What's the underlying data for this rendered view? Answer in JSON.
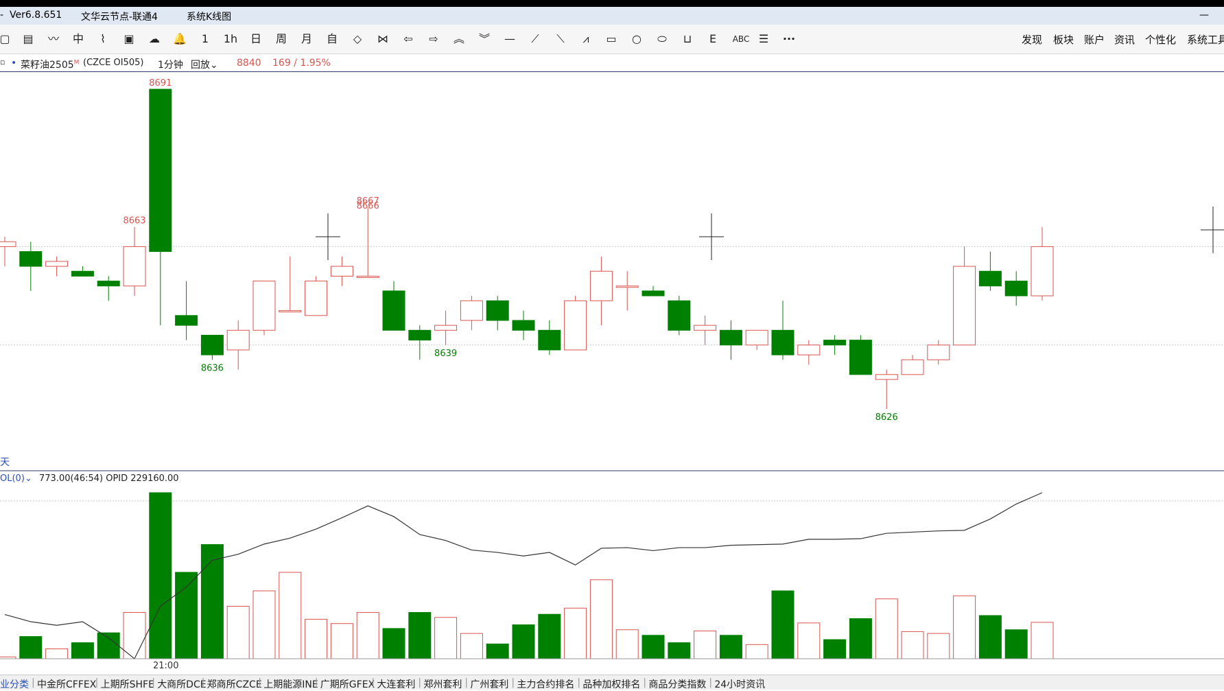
{
  "titlebar": {
    "left_dash": "-",
    "version": "Ver6.8.651",
    "node": "文华云节点-联通4",
    "window_name": "系统K线图",
    "minimize": "—"
  },
  "toolbar": {
    "icons": [
      "page-icon",
      "list-icon",
      "line-chart-icon",
      "candle-icon",
      "tick-icon",
      "report-icon",
      "cloud-icon",
      "bell-icon",
      "1m",
      "1h",
      "day",
      "week",
      "month",
      "custom",
      "left-right-icon",
      "bowtie-icon",
      "arrow-left-icon",
      "arrow-right-icon",
      "double-up-icon",
      "double-down-icon",
      "hline-icon",
      "ray-up-icon",
      "ray-down-icon",
      "zigzag-icon",
      "rect-icon",
      "circle-icon",
      "ellipse-icon",
      "ruler-icon",
      "fib-icon",
      "text-icon",
      "level-icon",
      "more-icon"
    ],
    "labels": {
      "t_1m": "1",
      "t_1h": "1h",
      "t_day": "日",
      "t_week": "周",
      "t_month": "月",
      "t_custom": "自",
      "abc": "ABC",
      "more": "···"
    },
    "right_menu": [
      "发现",
      "板块",
      "账户",
      "资讯",
      "个性化",
      "系统工具"
    ]
  },
  "infobar": {
    "contract": "菜籽油2505",
    "superscript": "M",
    "code": "(CZCE OI505)",
    "period": "1分钟",
    "replay": "回放",
    "price": "8840",
    "change": "169 / 1.95%"
  },
  "colors": {
    "up": "#d9534f",
    "down": "#008000",
    "link": "#2a4fb5",
    "grid": "#c8c8c8",
    "text": "#222222"
  },
  "chart_data": {
    "type": "candlestick",
    "price_labels": [
      {
        "value": "8691",
        "kind": "high"
      },
      {
        "value": "8667",
        "kind": "high"
      },
      {
        "value": "8666",
        "kind": "high"
      },
      {
        "value": "8663",
        "kind": "high"
      },
      {
        "value": "8636",
        "kind": "low"
      },
      {
        "value": "8639",
        "kind": "low"
      },
      {
        "value": "8626",
        "kind": "low"
      }
    ],
    "candles": [
      {
        "o": 8659,
        "h": 8661,
        "l": 8655,
        "c": 8660
      },
      {
        "o": 8658,
        "h": 8660,
        "l": 8650,
        "c": 8655
      },
      {
        "o": 8655,
        "h": 8657,
        "l": 8653,
        "c": 8656
      },
      {
        "o": 8654,
        "h": 8655,
        "l": 8653,
        "c": 8653
      },
      {
        "o": 8652,
        "h": 8653,
        "l": 8648,
        "c": 8651
      },
      {
        "o": 8651,
        "h": 8663,
        "l": 8649,
        "c": 8659
      },
      {
        "o": 8691,
        "h": 8691,
        "l": 8643,
        "c": 8658
      },
      {
        "o": 8645,
        "h": 8652,
        "l": 8640,
        "c": 8643
      },
      {
        "o": 8641,
        "h": 8641,
        "l": 8636,
        "c": 8637
      },
      {
        "o": 8638,
        "h": 8644,
        "l": 8634,
        "c": 8642
      },
      {
        "o": 8642,
        "h": 8648,
        "l": 8641,
        "c": 8652
      },
      {
        "o": 8646,
        "h": 8657,
        "l": 8646,
        "c": 8646
      },
      {
        "o": 8645,
        "h": 8653,
        "l": 8645,
        "c": 8652
      },
      {
        "o": 8653,
        "h": 8657,
        "l": 8651,
        "c": 8655
      },
      {
        "o": 8653,
        "h": 8667,
        "l": 8653,
        "c": 8653
      },
      {
        "o": 8650,
        "h": 8652,
        "l": 8643,
        "c": 8642
      },
      {
        "o": 8642,
        "h": 8643,
        "l": 8636,
        "c": 8640
      },
      {
        "o": 8642,
        "h": 8646,
        "l": 8639,
        "c": 8643
      },
      {
        "o": 8644,
        "h": 8649,
        "l": 8642,
        "c": 8648
      },
      {
        "o": 8648,
        "h": 8649,
        "l": 8642,
        "c": 8644
      },
      {
        "o": 8644,
        "h": 8646,
        "l": 8640,
        "c": 8642
      },
      {
        "o": 8642,
        "h": 8644,
        "l": 8637,
        "c": 8638
      },
      {
        "o": 8638,
        "h": 8649,
        "l": 8638,
        "c": 8648
      },
      {
        "o": 8648,
        "h": 8657,
        "l": 8643,
        "c": 8654
      },
      {
        "o": 8651,
        "h": 8654,
        "l": 8646,
        "c": 8651
      },
      {
        "o": 8650,
        "h": 8651,
        "l": 8649,
        "c": 8649
      },
      {
        "o": 8648,
        "h": 8649,
        "l": 8641,
        "c": 8642
      },
      {
        "o": 8642,
        "h": 8645,
        "l": 8639,
        "c": 8643
      },
      {
        "o": 8642,
        "h": 8644,
        "l": 8636,
        "c": 8639
      },
      {
        "o": 8639,
        "h": 8642,
        "l": 8638,
        "c": 8642
      },
      {
        "o": 8642,
        "h": 8648,
        "l": 8636,
        "c": 8637
      },
      {
        "o": 8637,
        "h": 8640,
        "l": 8635,
        "c": 8639
      },
      {
        "o": 8640,
        "h": 8641,
        "l": 8637,
        "c": 8639
      },
      {
        "o": 8640,
        "h": 8641,
        "l": 8634,
        "c": 8633
      },
      {
        "o": 8632,
        "h": 8634,
        "l": 8626,
        "c": 8633
      },
      {
        "o": 8633,
        "h": 8637,
        "l": 8633,
        "c": 8636
      },
      {
        "o": 8636,
        "h": 8640,
        "l": 8635,
        "c": 8639
      },
      {
        "o": 8639,
        "h": 8659,
        "l": 8639,
        "c": 8655
      },
      {
        "o": 8654,
        "h": 8658,
        "l": 8650,
        "c": 8651
      },
      {
        "o": 8652,
        "h": 8654,
        "l": 8647,
        "c": 8649
      },
      {
        "o": 8649,
        "h": 8663,
        "l": 8648,
        "c": 8659
      }
    ],
    "time_label": "21:00",
    "indicator_label": "OL(0)",
    "indicator_values": "773.00(46:54)  OPID 229160.00",
    "volume": [
      3,
      36,
      16,
      26,
      42,
      75,
      269,
      140,
      185,
      85,
      110,
      140,
      64,
      57,
      75,
      49,
      75,
      67,
      41,
      24,
      55,
      72,
      82,
      128,
      47,
      38,
      26,
      45,
      38,
      23,
      110,
      58,
      31,
      65,
      97,
      44,
      41,
      102,
      70,
      47,
      59
    ],
    "open_interest": [
      74,
      62,
      56,
      62,
      35,
      0,
      88,
      120,
      165,
      175,
      192,
      202,
      217,
      236,
      256,
      238,
      208,
      198,
      182,
      178,
      172,
      178,
      157,
      185,
      186,
      181,
      186,
      186,
      190,
      191,
      192,
      200,
      200,
      201,
      210,
      212,
      214,
      215,
      234,
      259,
      278
    ]
  },
  "bottom_tabs": [
    "业分类",
    "中金所CFFEX",
    "上期所SHFE",
    "大商所DCE",
    "郑商所CZCE",
    "上期能源INE",
    "广期所GFEX",
    "大连套利",
    "郑州套利",
    "广州套利",
    "主力合约排名",
    "品种加权排名",
    "商品分类指数",
    "24小时资讯"
  ],
  "left_labels": {
    "side_char": "天",
    "dot": "•",
    "square": "▫"
  }
}
